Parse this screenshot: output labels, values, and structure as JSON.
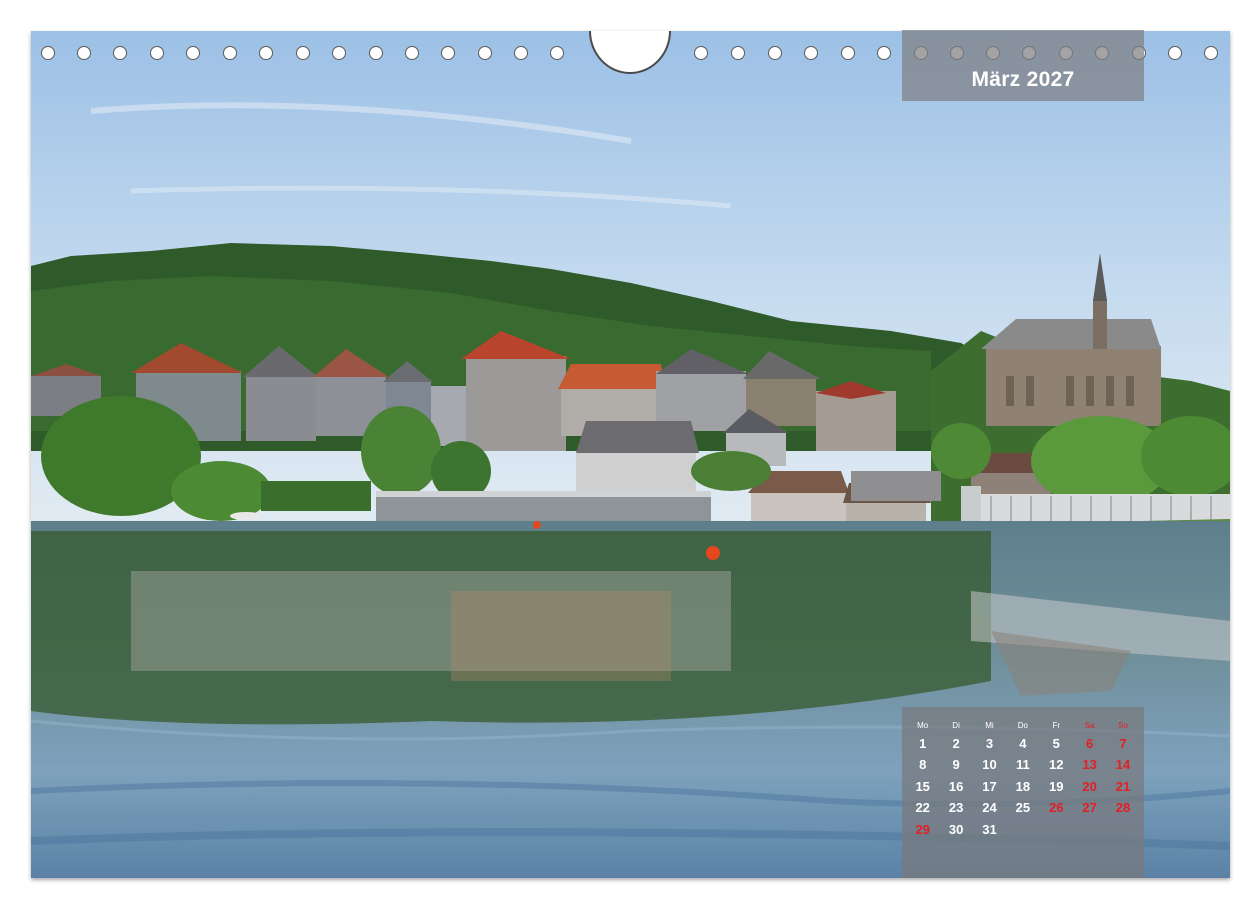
{
  "calendar": {
    "month_title": "März 2027",
    "weekdays": [
      "Mo",
      "Di",
      "Mi",
      "Do",
      "Fr",
      "Sa",
      "So"
    ],
    "weekend_color": "#e31e24",
    "weeks": [
      [
        "1",
        "2",
        "3",
        "4",
        "5",
        "6",
        "7"
      ],
      [
        "8",
        "9",
        "10",
        "11",
        "12",
        "13",
        "14"
      ],
      [
        "15",
        "16",
        "17",
        "18",
        "19",
        "20",
        "21"
      ],
      [
        "22",
        "23",
        "24",
        "25",
        "26",
        "27",
        "28"
      ],
      [
        "29",
        "30",
        "31",
        "",
        "",
        "",
        ""
      ]
    ],
    "red_days": [
      "6",
      "7",
      "13",
      "14",
      "20",
      "21",
      "26",
      "27",
      "28",
      "29"
    ]
  }
}
